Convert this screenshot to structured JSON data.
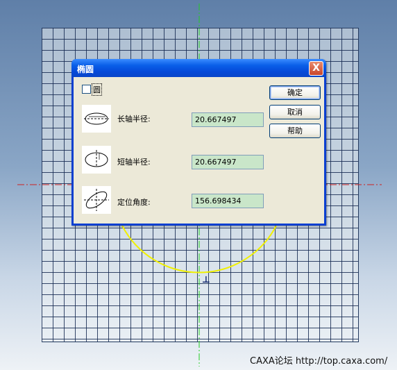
{
  "dialog": {
    "title": "椭圆",
    "close_label": "X",
    "checkbox": {
      "label": "圆",
      "checked": false
    },
    "rows": [
      {
        "label": "长轴半径:",
        "value": "20.667497"
      },
      {
        "label": "短轴半径:",
        "value": "20.667497"
      },
      {
        "label": "定位角度:",
        "value": "156.698434"
      }
    ],
    "buttons": {
      "ok": "确定",
      "cancel": "取消",
      "help": "帮助"
    }
  },
  "canvas": {
    "cursor_glyph": "⊥",
    "colors": {
      "arc": "#f0f000",
      "vertical_axis": "#22cc22",
      "horizontal_axis": "#cc2222"
    }
  },
  "watermark": "CAXA论坛 http://top.caxa.com/"
}
